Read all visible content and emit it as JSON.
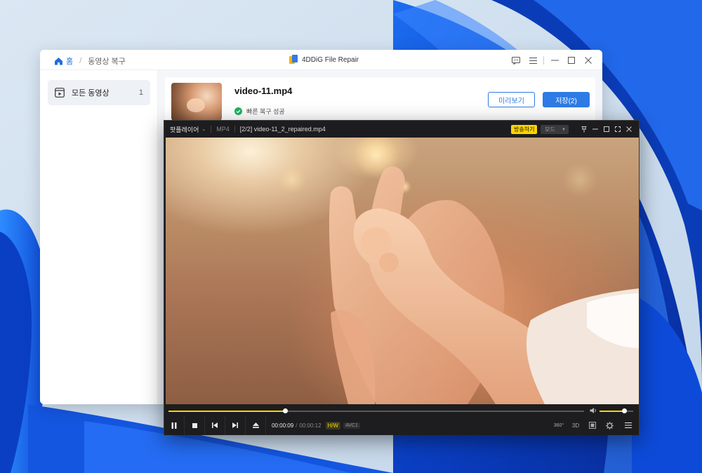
{
  "app": {
    "breadcrumb_home": "홈",
    "breadcrumb_current": "동영상 복구",
    "title": "4DDiG File Repair",
    "accent_color": "#2e7be6"
  },
  "sidebar": {
    "items": [
      {
        "label": "모든 동영상",
        "count": "1"
      }
    ]
  },
  "file": {
    "name": "video-11.mp4",
    "status": "빠른 복구 성공",
    "preview_label": "미리보기",
    "save_label": "저장(2)"
  },
  "player": {
    "menu_label": "팟플레이어",
    "format": "MP4",
    "file_title": "[2/2] video-11_2_repaired.mp4",
    "broadcast_label": "방송하기",
    "mode_label": "모드",
    "progress_fraction": 0.28,
    "volume_fraction": 0.72,
    "time_current": "00:00:09",
    "time_separator": "/",
    "time_total": "00:00:12",
    "hw_badge": "H/W",
    "codec_badge": "AVC1",
    "btn_360": "360°",
    "btn_3d": "3D",
    "accent_color": "#ffd400"
  }
}
